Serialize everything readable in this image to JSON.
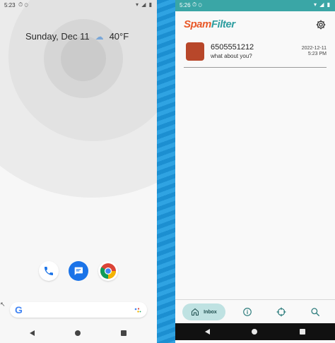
{
  "left_phone": {
    "status": {
      "time": "5:23",
      "icons_left": "⏱ ⊙",
      "icons_right": "▾ ◢ ▮"
    },
    "date": "Sunday, Dec 11",
    "weather": {
      "icon": "cloud-snow-icon",
      "temp": "40°F"
    },
    "dock": [
      {
        "name": "phone-app",
        "icon": "phone-icon"
      },
      {
        "name": "messages-app",
        "icon": "messages-icon"
      },
      {
        "name": "chrome-app",
        "icon": "chrome-icon"
      }
    ],
    "search": {
      "logo": "G",
      "icon": "google-assistant-icon"
    }
  },
  "right_phone": {
    "status": {
      "time": "5:26",
      "icons_left": "⏱ ⊙",
      "icons_right": "▾ ◢ ▮"
    },
    "app_title_part1": "Spam",
    "app_title_part2": "Filter",
    "colors": {
      "brand_orange": "#e85a2a",
      "brand_teal": "#2e9ea0",
      "status_teal": "#3aa6a6",
      "avatar": "#b8472a",
      "tab_active": "#bfe2e2"
    },
    "messages": [
      {
        "sender": "6505551212",
        "preview": "what about you?",
        "date": "2022-12-11",
        "time": "5:23 PM"
      }
    ],
    "tabs": [
      {
        "label": "Inbox",
        "icon": "home-icon",
        "active": true
      },
      {
        "label": "",
        "icon": "info-icon",
        "active": false
      },
      {
        "label": "",
        "icon": "target-icon",
        "active": false
      },
      {
        "label": "",
        "icon": "search-icon",
        "active": false
      }
    ]
  }
}
